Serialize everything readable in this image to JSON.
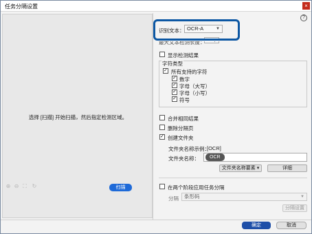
{
  "window": {
    "title": "任务分隔设置",
    "close_glyph": "×",
    "help_glyph": "?"
  },
  "preview": {
    "message": "选择 [扫描] 开始扫描，然后指定检测区域。",
    "scan_label": "扫描"
  },
  "ocr": {
    "label": "识别文本：",
    "value": "OCR-A",
    "partial_label": "最大文本检测长度：",
    "show_results_label": "显示检测结果"
  },
  "char_type": {
    "title": "字符类型",
    "all_supported": "所有支持的字符",
    "items": [
      "数字",
      "字母（大写）",
      "字母（小写）",
      "符号"
    ]
  },
  "options": {
    "merge_results": "合并相同结果",
    "delete_separator": "删除分隔页",
    "create_folder": "创建文件夹",
    "folder_example_label": "文件夹名称示例：",
    "folder_example_value": "[OCR]",
    "folder_name_label": "文件夹名称：",
    "folder_name_token": "OCR",
    "folder_elements_btn": "文件夹名称要素",
    "detail_btn": "详细"
  },
  "second_stage": {
    "label": "在两个阶段应用任务分隔",
    "sep_label": "分隔",
    "sep_value": "条形码",
    "settings_btn": "分隔设置"
  },
  "footer": {
    "ok": "确定",
    "cancel": "取消"
  },
  "colors": {
    "accent": "#1e4fa8",
    "highlight": "#0c57a3",
    "scan": "#1e6ad8"
  }
}
